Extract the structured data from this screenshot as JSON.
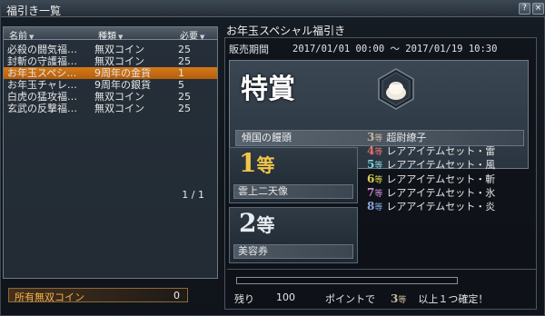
{
  "window": {
    "title": "福引き一覧",
    "help_label": "?",
    "close_label": "×"
  },
  "list": {
    "headers": {
      "name": "名前",
      "type": "種類",
      "required": "必要"
    },
    "rows": [
      {
        "name": "必殺の闘気福…",
        "type": "無双コイン",
        "required": "25"
      },
      {
        "name": "封斬の守護福…",
        "type": "無双コイン",
        "required": "25"
      },
      {
        "name": "お年玉スペシ…",
        "type": "9周年の金貨",
        "required": "1"
      },
      {
        "name": "お年玉チャレ…",
        "type": "9周年の銀貨",
        "required": "5"
      },
      {
        "name": "白虎の猛攻福…",
        "type": "無双コイン",
        "required": "25"
      },
      {
        "name": "玄武の反撃福…",
        "type": "無双コイン",
        "required": "25"
      }
    ],
    "selected_index": 2,
    "pager": "1 /  1"
  },
  "coins": {
    "label": "所有無双コイン",
    "value": "0"
  },
  "detail": {
    "title": "お年玉スペシャル福引き",
    "sale_label": "販売期間",
    "sale_period": "2017/01/01 00:00 〜 2017/01/19 10:30",
    "grand_prize": {
      "title": "特賞",
      "item": "傾国の饅頭",
      "icon": "bun-item-icon"
    },
    "first": {
      "num": "1",
      "kanji": "等",
      "item": "雲上二天像"
    },
    "second": {
      "num": "2",
      "kanji": "等",
      "item": "美容券"
    },
    "other_ranks": [
      {
        "num": "3",
        "kanji": "等",
        "item": "超尉繚子",
        "color": "#c9b99a"
      },
      {
        "num": "4",
        "kanji": "等",
        "item": "レアアイテムセット・雷",
        "color": "#e8736a"
      },
      {
        "num": "5",
        "kanji": "等",
        "item": "レアアイテムセット・風",
        "color": "#7fd1d9"
      },
      {
        "num": "6",
        "kanji": "等",
        "item": "レアアイテムセット・斬",
        "color": "#d9d14a"
      },
      {
        "num": "7",
        "kanji": "等",
        "item": "レアアイテムセット・氷",
        "color": "#d28ad9"
      },
      {
        "num": "8",
        "kanji": "等",
        "item": "レアアイテムセット・炎",
        "color": "#8aa6e0"
      }
    ],
    "remaining_label": "残り",
    "remaining_value": "100",
    "progress_fraction": 0.0,
    "guarantee_prefix": "ポイントで",
    "guarantee_num": "3",
    "guarantee_kanji": "等",
    "guarantee_suffix": "以上１つ確定！",
    "colors": {
      "first": "#f2c64a",
      "second": "#e8ecf0",
      "selected": "#c96a12"
    }
  }
}
